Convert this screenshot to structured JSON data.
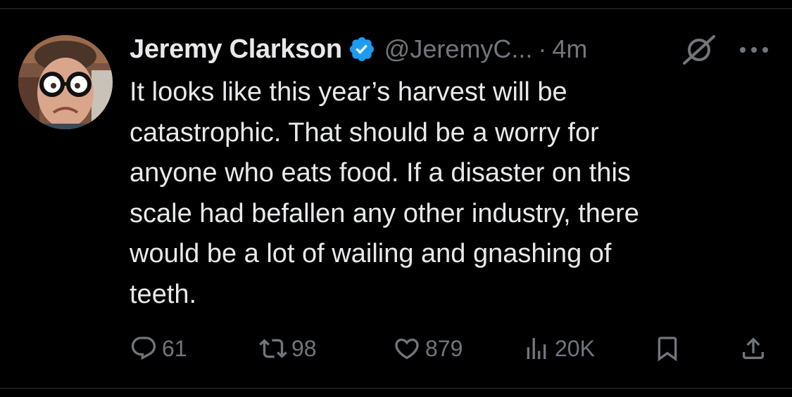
{
  "author": {
    "display_name": "Jeremy Clarkson",
    "handle": "@JeremyC...",
    "separator": "·",
    "time": "4m",
    "verified": true
  },
  "tweet": {
    "text": "It looks like this year’s harvest will be\ncatastrophic. That should be a worry for\nanyone who eats food. If a disaster on this\nscale had befallen any other industry, there\nwould be a lot of wailing and gnashing of\nteeth."
  },
  "actions": {
    "replies": "61",
    "reposts": "98",
    "likes": "879",
    "views": "20K"
  },
  "icons": {
    "verified": "verified-badge-icon",
    "grok": "grok-icon",
    "more": "more-icon",
    "reply": "reply-icon",
    "repost": "repost-icon",
    "like": "heart-icon",
    "views": "views-icon",
    "bookmark": "bookmark-icon",
    "share": "share-icon"
  },
  "colors": {
    "background": "#000000",
    "text_primary": "#e7e9ea",
    "text_secondary": "#71767b",
    "verified_blue": "#1d9bf0",
    "divider": "#2f3336"
  }
}
